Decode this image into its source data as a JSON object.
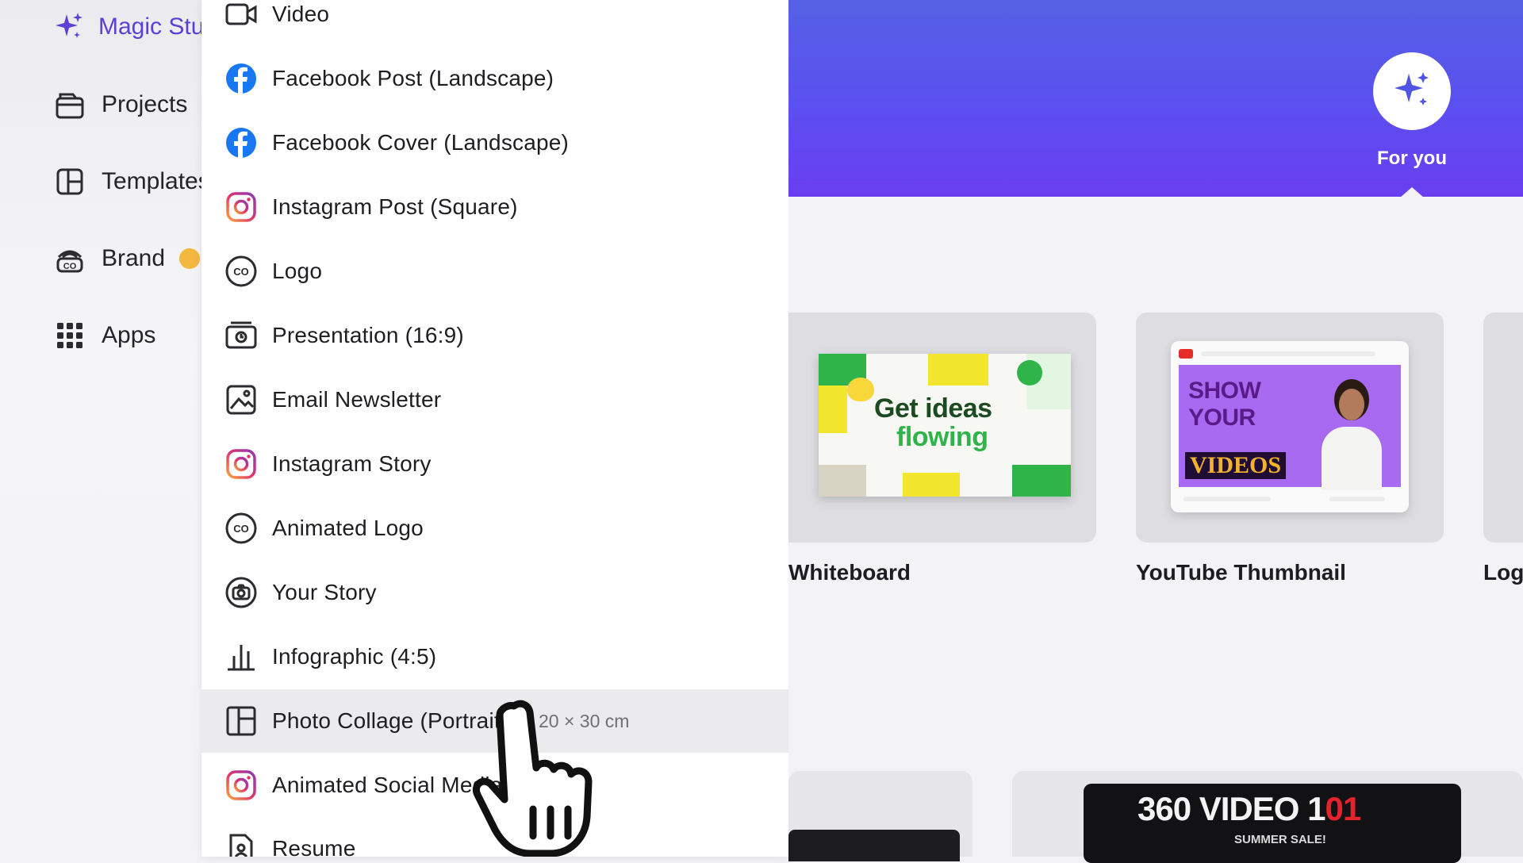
{
  "sidebar": {
    "items": [
      {
        "label": "Magic Studio",
        "icon": "magic-sparkle-icon"
      },
      {
        "label": "Projects",
        "icon": "folder-icon"
      },
      {
        "label": "Templates",
        "icon": "template-icon"
      },
      {
        "label": "Brand",
        "icon": "brand-icon"
      },
      {
        "label": "Apps",
        "icon": "apps-grid-icon"
      }
    ]
  },
  "menu": {
    "items": [
      {
        "label": "Video",
        "icon": "video-camera-icon"
      },
      {
        "label": "Facebook Post (Landscape)",
        "icon": "facebook-icon"
      },
      {
        "label": "Facebook Cover (Landscape)",
        "icon": "facebook-icon"
      },
      {
        "label": "Instagram Post (Square)",
        "icon": "instagram-icon"
      },
      {
        "label": "Logo",
        "icon": "logo-co-icon"
      },
      {
        "label": "Presentation (16:9)",
        "icon": "presentation-icon"
      },
      {
        "label": "Email Newsletter",
        "icon": "image-icon"
      },
      {
        "label": "Instagram Story",
        "icon": "instagram-icon"
      },
      {
        "label": "Animated Logo",
        "icon": "logo-co-icon"
      },
      {
        "label": "Your Story",
        "icon": "camera-icon"
      },
      {
        "label": "Infographic (4:5)",
        "icon": "bar-chart-icon"
      },
      {
        "label": "Photo Collage (Portrait)",
        "icon": "collage-layout-icon",
        "dimensions": "20 × 30 cm"
      },
      {
        "label": "Animated Social Media",
        "icon": "instagram-icon"
      },
      {
        "label": "Resume",
        "icon": "resume-icon"
      }
    ]
  },
  "hero": {
    "foryou_label": "For you",
    "foryou_icon": "sparkle-icon"
  },
  "cards": [
    {
      "title": "Whiteboard",
      "thumb_line1": "Get ideas",
      "thumb_line2": "flowing"
    },
    {
      "title": "YouTube Thumbnail",
      "thumb_line1": "SHOW",
      "thumb_line2": "YOUR",
      "thumb_line3": "VIDEOS"
    },
    {
      "title": "Logo"
    }
  ],
  "bottom": {
    "banner_title_a": "360 VIDEO 1",
    "banner_title_b": "01",
    "banner_sub": "SUMMER SALE!"
  },
  "colors": {
    "accent": "#5b3fd6",
    "hero_top": "#5561e4",
    "hero_bottom": "#6a3ef0",
    "facebook": "#1877f2",
    "instagram": "#e1306c",
    "hover_bg": "#ebebee"
  }
}
